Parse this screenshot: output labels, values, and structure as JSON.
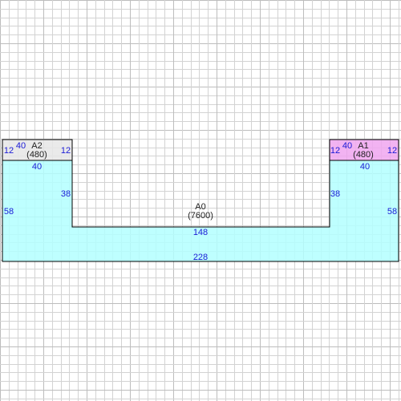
{
  "colors": {
    "grid_minor": "#d3d3d3",
    "grid_major": "#bdbdbd",
    "a0_fill": "#b3ffff",
    "a1_fill": "#f0a6f0",
    "a2_fill": "#e6e6e6",
    "outline": "#000000",
    "dimension_text": "#1a1ad6"
  },
  "areas": {
    "a0": {
      "name": "A0",
      "value": "(7600)"
    },
    "a1": {
      "name": "A1",
      "value": "(480)"
    },
    "a2": {
      "name": "A2",
      "value": "(480)"
    }
  },
  "dimensions": {
    "a2_left": "12",
    "a2_top": "40",
    "a2_right": "12",
    "a2_bottom": "40",
    "a1_left": "12",
    "a1_top": "40",
    "a1_right": "12",
    "a1_bottom": "40",
    "left_inner": "38",
    "left_outer": "58",
    "right_inner": "38",
    "right_outer": "58",
    "middle": "148",
    "bottom": "228"
  }
}
